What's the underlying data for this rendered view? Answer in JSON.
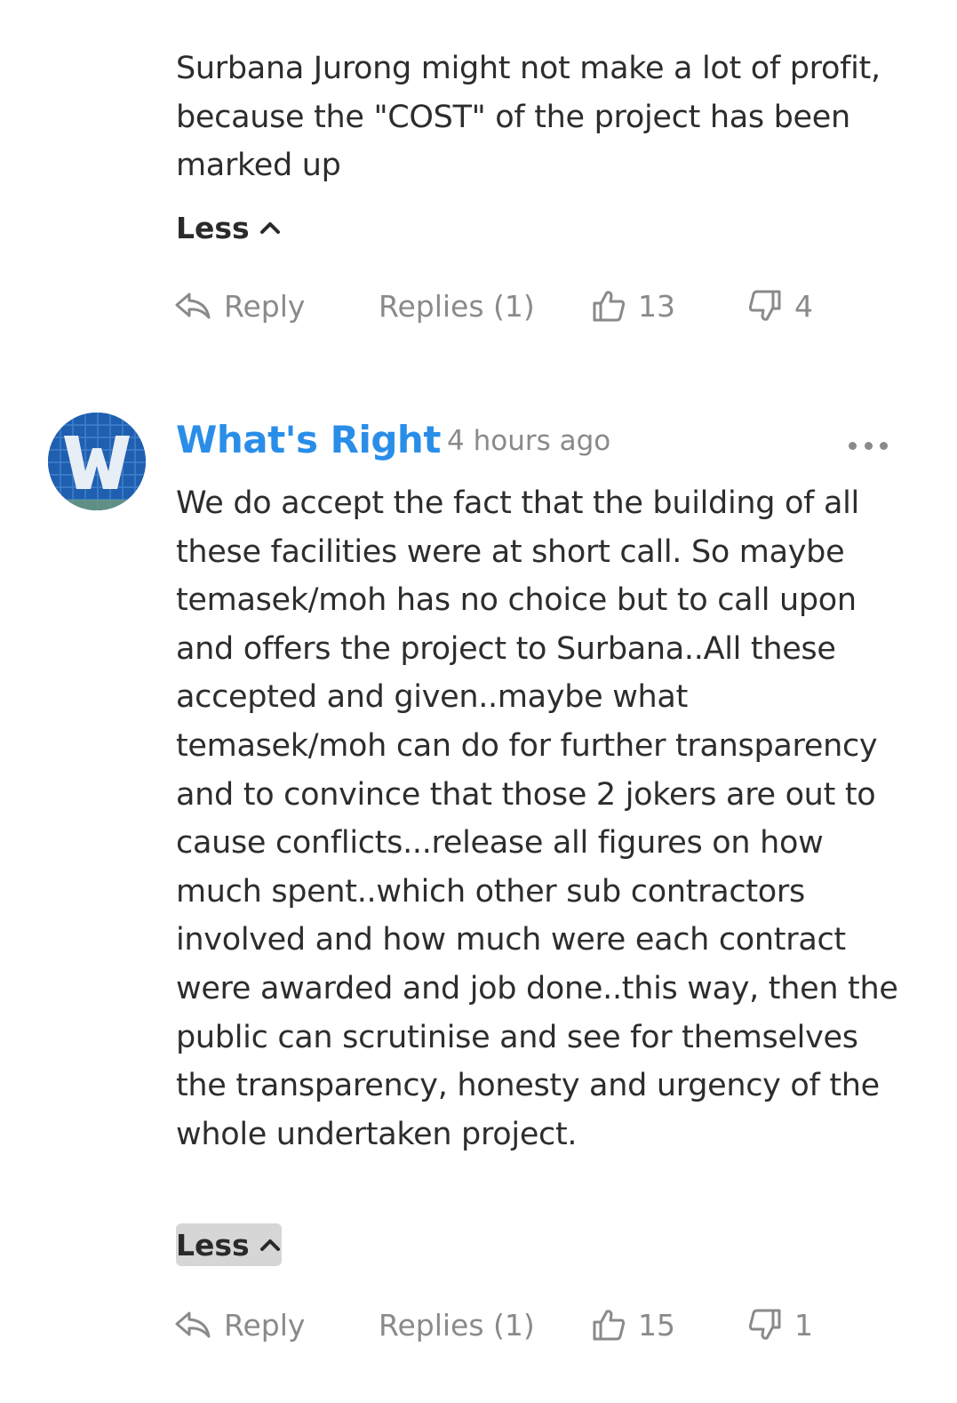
{
  "comment1": {
    "text": "Surbana Jurong might not make a lot of profit, because the \"COST\" of the project has been marked up",
    "less_label": "Less",
    "reply_label": "Reply",
    "replies_label": "Replies (1)",
    "likes": "13",
    "dislikes": "4"
  },
  "comment2": {
    "author": "What's Right",
    "avatar_letter": "W",
    "timestamp": "4 hours ago",
    "text": "We do accept the fact that the building of all these facilities were at short call. So maybe temasek/moh has no choice but to call upon and offers the project to Surbana..All these accepted and given..maybe what temasek/moh can do for further transparency and to convince that those 2 jokers are out to cause conflicts...release all figures on how much spent..which other sub contractors involved and how much were each contract were awarded and job done..this way, then the public can scrutinise and see for themselves the transparency, honesty and urgency of the whole undertaken project.",
    "less_label": "Less",
    "reply_label": "Reply",
    "replies_label": "Replies (1)",
    "likes": "15",
    "dislikes": "1"
  },
  "icons": {
    "reply": "reply-arrow-icon",
    "like": "thumbs-up-icon",
    "dislike": "thumbs-down-icon",
    "collapse": "chevron-up-icon",
    "more": "more-dots-icon"
  },
  "colors": {
    "author": "#2a8ee8",
    "muted": "#8a8a8a",
    "text": "#2d2d2d",
    "avatar_bg": "#1f5fb0"
  }
}
